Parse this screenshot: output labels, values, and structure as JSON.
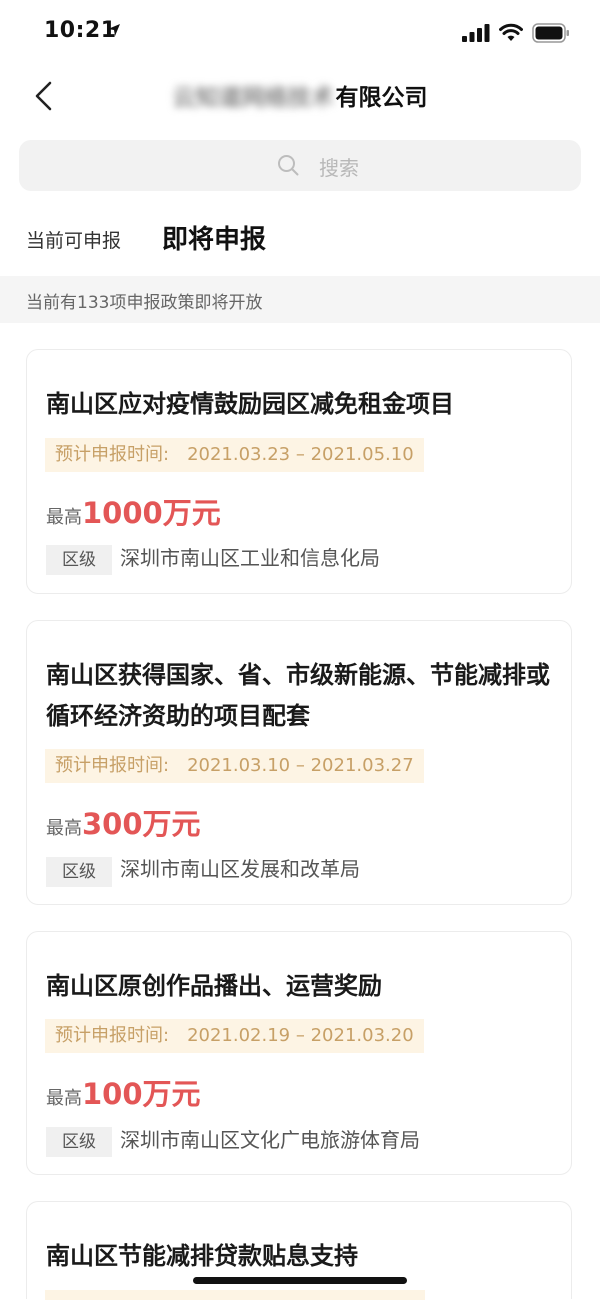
{
  "status_bar": {
    "time": "10:21"
  },
  "nav": {
    "title_blurred": "云知道网络技术",
    "title_suffix": "有限公司"
  },
  "search": {
    "placeholder": "搜索"
  },
  "tabs": {
    "current": "当前可申报",
    "upcoming": "即将申报"
  },
  "info": {
    "text": "当前有133项申报政策即将开放"
  },
  "cards": [
    {
      "title": "南山区应对疫情鼓励园区减免租金项目",
      "date_label": "预计申报时间:",
      "date_range": "2021.03.23 – 2021.05.10",
      "amount_prefix": "最高",
      "amount": "1000万元",
      "level": "区级",
      "agency": "深圳市南山区工业和信息化局"
    },
    {
      "title": "南山区获得国家、省、市级新能源、节能减排或循环经济资助的项目配套",
      "date_label": "预计申报时间:",
      "date_range": "2021.03.10 – 2021.03.27",
      "amount_prefix": "最高",
      "amount": "300万元",
      "level": "区级",
      "agency": "深圳市南山区发展和改革局"
    },
    {
      "title": "南山区原创作品播出、运营奖励",
      "date_label": "预计申报时间:",
      "date_range": "2021.02.19 – 2021.03.20",
      "amount_prefix": "最高",
      "amount": "100万元",
      "level": "区级",
      "agency": "深圳市南山区文化广电旅游体育局"
    },
    {
      "title": "南山区节能减排贷款贴息支持"
    }
  ],
  "colors": {
    "accent_red": "#e35656",
    "date_tag_bg": "#fdf4e4",
    "date_tag_text": "#c7a067"
  }
}
